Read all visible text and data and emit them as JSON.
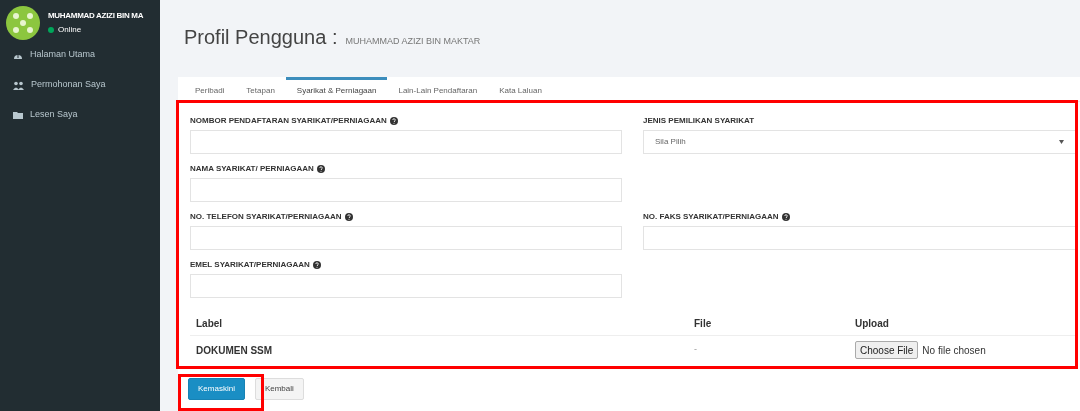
{
  "user": {
    "name": "MUHAMMAD AZIZI BIN MA",
    "status": "Online"
  },
  "menu": [
    {
      "label": "Halaman Utama"
    },
    {
      "label": "Permohonan Saya"
    },
    {
      "label": "Lesen Saya"
    }
  ],
  "page": {
    "title": "Profil Pengguna :",
    "subtitle": "MUHAMMAD AZIZI BIN MAKTAR"
  },
  "tabs": [
    {
      "label": "Peribadi",
      "selected": false
    },
    {
      "label": "Tetapan",
      "selected": false
    },
    {
      "label": "Syarikat & Perniagaan",
      "selected": true
    },
    {
      "label": "Lain-Lain Pendaftaran",
      "selected": false
    },
    {
      "label": "Kata Laluan",
      "selected": false
    }
  ],
  "form_rows": [
    {
      "left": {
        "label": "NOMBOR PENDAFTARAN SYARIKAT/PERNIAGAAN",
        "help": true,
        "kind": "text"
      },
      "right": {
        "label": "JENIS PEMILIKAN SYARIKAT",
        "help": false,
        "kind": "select",
        "value": "Sila Pilih"
      }
    },
    {
      "left": {
        "label": "NAMA SYARIKAT/ PERNIAGAAN",
        "help": true,
        "kind": "text"
      }
    },
    {
      "left": {
        "label": "NO. TELEFON SYARIKAT/PERNIAGAAN",
        "help": true,
        "kind": "text"
      },
      "right": {
        "label": "NO. FAKS SYARIKAT/PERNIAGAAN",
        "help": true,
        "kind": "text"
      }
    },
    {
      "left": {
        "label": "EMEL SYARIKAT/PERNIAGAAN",
        "help": true,
        "kind": "text"
      }
    }
  ],
  "table": {
    "columns": [
      "Label",
      "File",
      "Upload"
    ],
    "rows": [
      {
        "label": "DOKUMEN SSM",
        "file": "-",
        "upload_button": "Choose File",
        "upload_status": "No file chosen"
      }
    ]
  },
  "buttons": [
    {
      "label": "Kemaskini",
      "kind": "primary"
    },
    {
      "label": "Kembali",
      "kind": "default"
    }
  ]
}
